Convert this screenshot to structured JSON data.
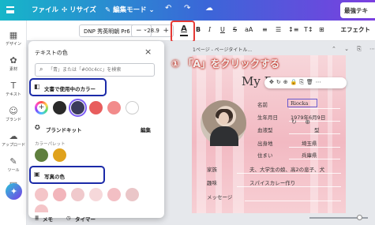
{
  "topbar": {
    "file": "ファイル",
    "resize": "✣ リサイズ",
    "edit_mode": "✎ 編集モード ⌄",
    "undo_icon": "↶",
    "redo_icon": "↷",
    "cloud_icon": "☁",
    "right_label": "最強テキ"
  },
  "rail": {
    "items": [
      {
        "icon": "▦",
        "label": "デザイン"
      },
      {
        "icon": "✿",
        "label": "素材"
      },
      {
        "icon": "T",
        "label": "テキスト"
      },
      {
        "icon": "☺",
        "label": "ブランド"
      },
      {
        "icon": "☁",
        "label": "アップロード"
      },
      {
        "icon": "✎",
        "label": "ツール"
      },
      {
        "icon": "▤",
        "label": "プロ"
      }
    ],
    "magic_icon": "✦"
  },
  "toolbar": {
    "font": "DNP 秀英明朝 Pr6",
    "font_chevron": "⌄",
    "size_minus": "−",
    "size": "28.9",
    "size_plus": "+",
    "color_letter": "A",
    "bold": "B",
    "italic": "I",
    "underline": "U",
    "strike": "S",
    "case": "aA",
    "align": "≡",
    "list": "☰",
    "spacing": "↕≡",
    "vertical": "T↕",
    "more_icon": "⊞",
    "effect": "エフェクト"
  },
  "panel": {
    "title": "テキストの色",
    "close_icon": "×",
    "search_placeholder": "「青」または「#00c4cc」を検索",
    "doc_colors_title": "文書で使用中のカラー",
    "doc_colors": [
      "#2a2a2a",
      "#3b3b5c",
      "#e85d5d",
      "#f28b8b",
      "#ffffff"
    ],
    "brand_title": "ブランドキット",
    "edit": "編集",
    "palette_label": "カラーパレット",
    "brand_colors": [
      "#5f7f3e",
      "#e0a21c"
    ],
    "photo_title": "写真の色",
    "photo_colors": [
      "#f4c5c8",
      "#f2b5bb",
      "#f0c9cc",
      "#f6d8da",
      "#f3bfc4",
      "#eac6c8"
    ],
    "notes": "メモ",
    "timer": "タイマー"
  },
  "canvas": {
    "page_label": "1ページ - ページタイトル...",
    "page_tools": "⌃ ⌄ ⎘ ⋯",
    "annotation": "① 「A」をクリックする",
    "title": "My P",
    "object_tools": "✥↻⊕🔒⎘🗑⋯",
    "fields": [
      {
        "label": "名前",
        "value": "Riocka"
      },
      {
        "label": "生年月日",
        "value": "1979年6月9日"
      },
      {
        "label": "血液型",
        "value": "型"
      },
      {
        "label": "出身地",
        "value": "埼玉県"
      },
      {
        "label": "住まい",
        "value": "兵庫県"
      }
    ],
    "lower_fields": [
      {
        "label": "家族",
        "value": "夫、大学生の娘、高2の息子、犬"
      },
      {
        "label": "趣味",
        "value": "スパイスカレー作り"
      },
      {
        "label": "メッセージ",
        "value": ""
      }
    ],
    "rotate_handle": "↻ ⊕"
  }
}
